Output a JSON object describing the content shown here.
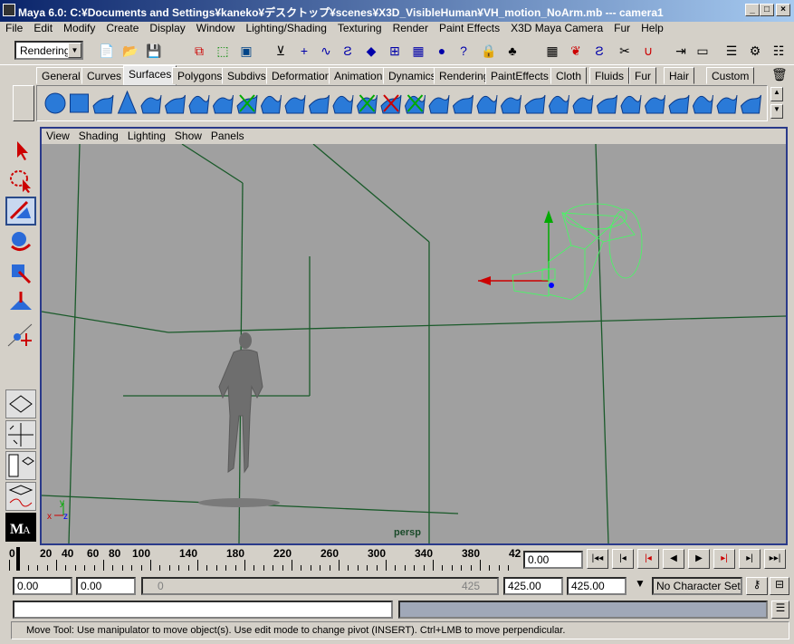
{
  "window": {
    "title": "Maya 6.0: C:¥Documents and Settings¥kaneko¥デスクトップ¥scenes¥X3D_VisibleHuman¥VH_motion_NoArm.mb   ---   camera1",
    "minimize": "_",
    "maximize": "□",
    "close": "×"
  },
  "menubar": [
    "File",
    "Edit",
    "Modify",
    "Create",
    "Display",
    "Window",
    "Lighting/Shading",
    "Texturing",
    "Render",
    "Paint Effects",
    "X3D Maya Camera",
    "Fur",
    "Help"
  ],
  "status_line": {
    "menuset": "Rendering"
  },
  "shelf": {
    "tabs": [
      "General",
      "Curves",
      "Surfaces",
      "Polygons",
      "Subdivs",
      "Deformation",
      "Animation",
      "Dynamics",
      "Rendering",
      "PaintEffects",
      "Cloth",
      "Fluids",
      "Fur",
      "Hair",
      "Custom"
    ],
    "active_tab": "Surfaces"
  },
  "panel": {
    "menu": [
      "View",
      "Shading",
      "Lighting",
      "Show",
      "Panels"
    ],
    "camera_label": "persp",
    "axis_x": "x",
    "axis_y": "y",
    "axis_z": "z"
  },
  "timeline": {
    "ticks": [
      "0",
      "20",
      "40",
      "60",
      "80",
      "100",
      "140",
      "180",
      "220",
      "260",
      "300",
      "340",
      "380",
      "42"
    ],
    "current_time": "0.00"
  },
  "range_slider": {
    "start_time": "0.00",
    "playback_start": "0.00",
    "range_start_label": "0",
    "range_end_label": "425",
    "playback_end": "425.00",
    "end_time": "425.00",
    "character_set": "No Character Set"
  },
  "help_line": "Move Tool: Use manipulator to move object(s). Use edit mode to change pivot (INSERT).  Ctrl+LMB to move perpendicular.",
  "colors": {
    "viewport_bg": "#a0a0a0",
    "grid_line": "#1a5a2a",
    "camera_wire": "#40ff60",
    "panel_border": "#2a3a8a",
    "shelf_icon": "#2a7ad8"
  }
}
